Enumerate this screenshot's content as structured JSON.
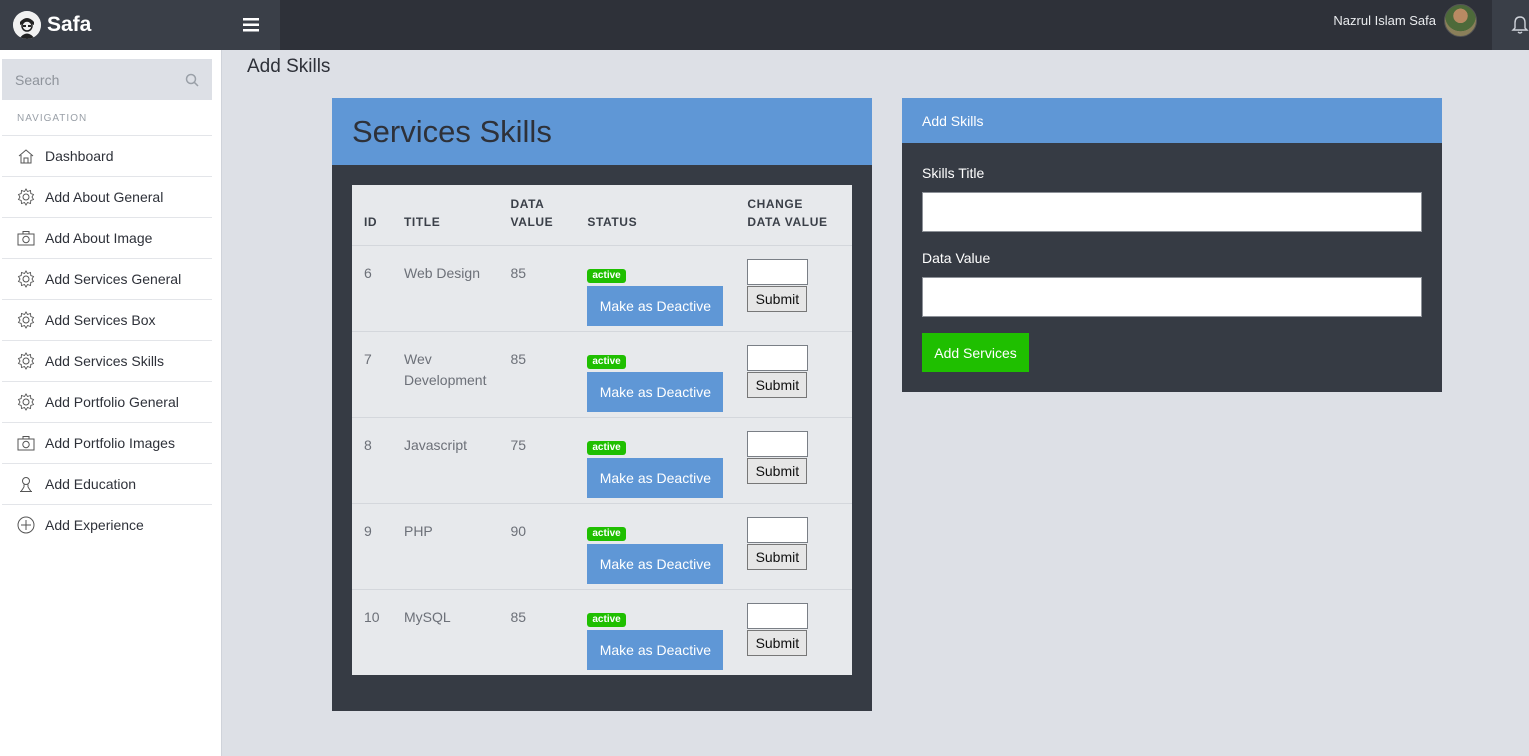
{
  "app": {
    "brand": "Safa"
  },
  "user": {
    "name": "Nazrul Islam Safa"
  },
  "sidebar": {
    "search_placeholder": "Search",
    "caption": "NAVIGATION",
    "items": [
      {
        "label": "Dashboard",
        "icon": "home-icon"
      },
      {
        "label": "Add About General",
        "icon": "gear-icon"
      },
      {
        "label": "Add About Image",
        "icon": "camera-icon"
      },
      {
        "label": "Add Services General",
        "icon": "gear-icon"
      },
      {
        "label": "Add Services Box",
        "icon": "gear-icon"
      },
      {
        "label": "Add Services Skills",
        "icon": "gear-icon"
      },
      {
        "label": "Add Portfolio General",
        "icon": "gear-icon"
      },
      {
        "label": "Add Portfolio Images",
        "icon": "camera-icon"
      },
      {
        "label": "Add Education",
        "icon": "user-icon"
      },
      {
        "label": "Add Experience",
        "icon": "plus-circle-icon"
      }
    ]
  },
  "page": {
    "title": "Add Skills"
  },
  "skills_panel": {
    "title": "Services Skills",
    "columns": [
      "ID",
      "TITLE",
      "DATA VALUE",
      "STATUS",
      "CHANGE DATA VALUE"
    ],
    "rows": [
      {
        "id": "6",
        "title": "Web Design",
        "value": "85",
        "status": "active",
        "action": "Make as Deactive",
        "submit": "Submit"
      },
      {
        "id": "7",
        "title": "Wev Development",
        "value": "85",
        "status": "active",
        "action": "Make as Deactive",
        "submit": "Submit"
      },
      {
        "id": "8",
        "title": "Javascript",
        "value": "75",
        "status": "active",
        "action": "Make as Deactive",
        "submit": "Submit"
      },
      {
        "id": "9",
        "title": "PHP",
        "value": "90",
        "status": "active",
        "action": "Make as Deactive",
        "submit": "Submit"
      },
      {
        "id": "10",
        "title": "MySQL",
        "value": "85",
        "status": "active",
        "action": "Make as Deactive",
        "submit": "Submit"
      }
    ]
  },
  "form": {
    "title": "Add Skills",
    "skills_title_label": "Skills Title",
    "skills_title_value": "",
    "data_value_label": "Data Value",
    "data_value_value": "",
    "submit_label": "Add Services"
  },
  "colors": {
    "topbar": "#2e3139",
    "accent_blue": "#5f97d6",
    "success_green": "#1fbf00",
    "panel_dark": "#363b44",
    "page_bg": "#dde0e6"
  }
}
